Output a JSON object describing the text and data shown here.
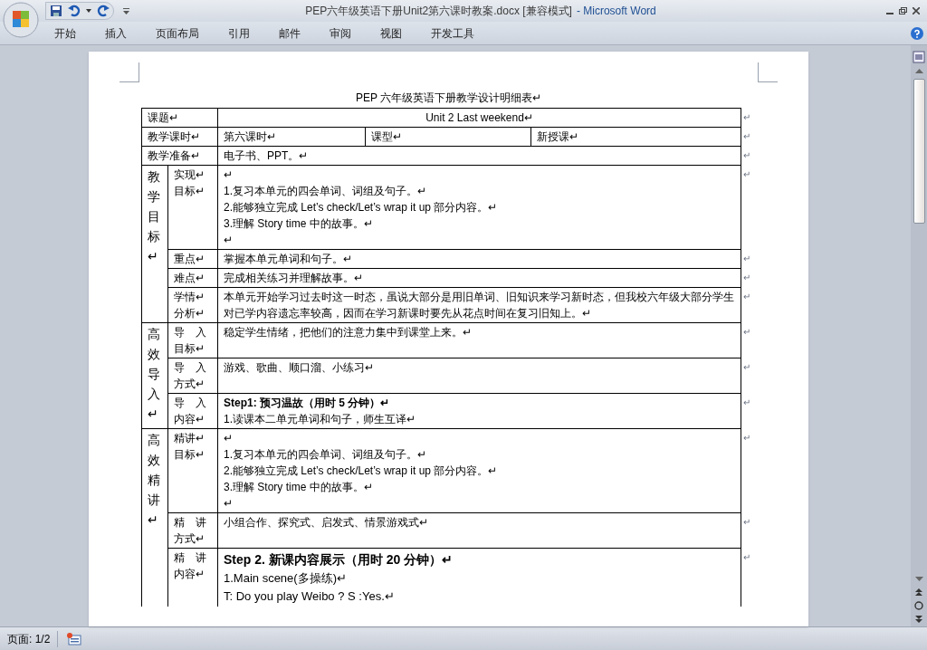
{
  "window": {
    "title": "PEP六年级英语下册Unit2第六课时教案.docx [兼容模式]",
    "app_name": "- Microsoft Word"
  },
  "ribbon_tabs": [
    "开始",
    "插入",
    "页面布局",
    "引用",
    "邮件",
    "审阅",
    "视图",
    "开发工具"
  ],
  "document": {
    "title": "PEP 六年级英语下册教学设计明细表↵",
    "rows": [
      {
        "kind": "title-span",
        "label": [
          "课题↵"
        ],
        "value": "Unit 2     Last weekend↵",
        "mark": "↵"
      },
      {
        "kind": "split",
        "label": [
          "教学课时↵"
        ],
        "cells": [
          "第六课时↵",
          "课型↵",
          "新授课↵"
        ],
        "mark": "↵"
      },
      {
        "kind": "span",
        "label": [
          "教学准备↵"
        ],
        "value": "电子书、PPT。↵",
        "mark": "↵"
      },
      {
        "kind": "group",
        "group_label": "教学目标↵",
        "rows": [
          {
            "label": [
              "实现↵",
              "目标↵"
            ],
            "lines": [
              {
                "text": "↵",
                "kind": "text"
              },
              {
                "text": "1.复习本单元的四会单词、词组及句子。↵",
                "kind": "text"
              },
              {
                "text": "2.能够独立完成 Let’s check/Let’s wrap it up 部分内容。↵",
                "kind": "text"
              },
              {
                "text": "3.理解 Story time  中的故事。↵",
                "kind": "text"
              },
              {
                "text": "↵",
                "kind": "text"
              }
            ],
            "mark": "↵"
          },
          {
            "label": [
              "重点↵"
            ],
            "lines": [
              {
                "text": "掌握本单元单词和句子。↵",
                "kind": "text"
              }
            ],
            "mark": "↵"
          },
          {
            "label": [
              "难点↵"
            ],
            "lines": [
              {
                "text": "完成相关练习并理解故事。↵",
                "kind": "text"
              }
            ],
            "mark": "↵"
          },
          {
            "label": [
              "学情↵",
              "分析↵"
            ],
            "lines": [
              {
                "text": "本单元开始学习过去时这一时态，虽说大部分是用旧单词、旧知识来学习新时态，但我校六年级大部分学生对已学内容遗忘率较高，因而在学习新课时要先从花点时间在复习旧知上。↵",
                "kind": "text"
              }
            ],
            "mark": "↵"
          }
        ]
      },
      {
        "kind": "group",
        "group_label": "高效导入↵",
        "rows": [
          {
            "label": [
              "导　入",
              "目标↵"
            ],
            "lines": [
              {
                "text": "稳定学生情绪，把他们的注意力集中到课堂上来。↵",
                "kind": "text"
              }
            ],
            "mark": "↵"
          },
          {
            "label": [
              "导　入",
              "方式↵"
            ],
            "lines": [
              {
                "text": "游戏、歌曲、顺口溜、小练习↵",
                "kind": "text"
              }
            ],
            "mark": "↵"
          },
          {
            "label": [
              "导　入",
              "内容↵"
            ],
            "lines": [
              {
                "text": "Step1: 预习温故（用时 5 分钟）↵",
                "kind": "heading"
              },
              {
                "text": "1.读课本二单元单词和句子，师生互译↵",
                "kind": "text"
              }
            ],
            "mark": "↵"
          }
        ]
      },
      {
        "kind": "group",
        "group_label": "高效精讲↵",
        "rows": [
          {
            "label": [
              "精讲↵",
              "目标↵"
            ],
            "lines": [
              {
                "text": "↵",
                "kind": "text"
              },
              {
                "text": "1.复习本单元的四会单词、词组及句子。↵",
                "kind": "text"
              },
              {
                "text": "2.能够独立完成 Let’s check/Let’s wrap it up 部分内容。↵",
                "kind": "text"
              },
              {
                "text": "3.理解 Story time  中的故事。↵",
                "kind": "text"
              },
              {
                "text": "↵",
                "kind": "text"
              }
            ],
            "mark": "↵"
          },
          {
            "label": [
              "精　讲",
              "方式↵"
            ],
            "lines": [
              {
                "text": "小组合作、探究式、启发式、情景游戏式↵",
                "kind": "text"
              }
            ],
            "mark": "↵"
          },
          {
            "label": [
              "精　讲",
              "内容↵"
            ],
            "lines": [
              {
                "text": "Step 2. 新课内容展示（用时 20 分钟）↵",
                "kind": "large-heading"
              },
              {
                "text": "1.Main scene(多操练)↵",
                "kind": "large-text"
              },
              {
                "text": "T: Do you play Weibo ?      S :Yes.↵",
                "kind": "large-text"
              }
            ],
            "mark": "↵"
          }
        ]
      }
    ]
  },
  "status_bar": {
    "page": "页面: 1/2"
  }
}
